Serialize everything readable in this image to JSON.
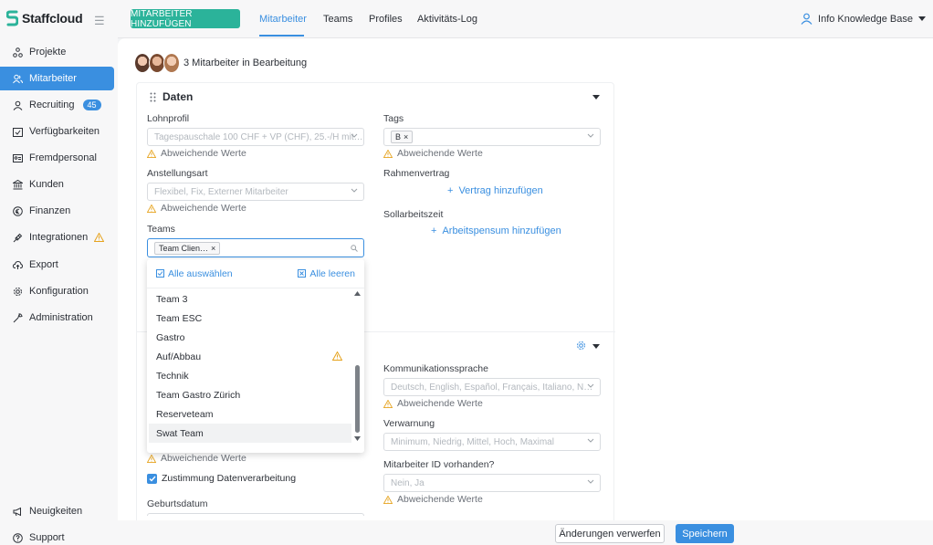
{
  "app": {
    "logo_text": "Staffcloud"
  },
  "sidebar": {
    "items": [
      {
        "label": "Projekte",
        "icon": "projects-icon"
      },
      {
        "label": "Mitarbeiter",
        "icon": "staff-icon"
      },
      {
        "label": "Recruiting",
        "icon": "recruiting-icon",
        "badge": "45"
      },
      {
        "label": "Verfügbarkeiten",
        "icon": "calendar-check-icon"
      },
      {
        "label": "Fremdpersonal",
        "icon": "id-card-icon"
      },
      {
        "label": "Kunden",
        "icon": "bank-icon"
      },
      {
        "label": "Finanzen",
        "icon": "currency-icon"
      },
      {
        "label": "Integrationen",
        "icon": "plug-icon"
      },
      {
        "label": "Export",
        "icon": "cloud-upload-icon"
      },
      {
        "label": "Konfiguration",
        "icon": "gear-icon"
      },
      {
        "label": "Administration",
        "icon": "wrench-icon"
      }
    ],
    "bottom": [
      {
        "label": "Neuigkeiten",
        "icon": "megaphone-icon"
      },
      {
        "label": "Support",
        "icon": "help-icon"
      }
    ]
  },
  "topbar": {
    "add_button": "MITARBEITER HINZUFÜGEN",
    "tabs": [
      "Mitarbeiter",
      "Teams",
      "Profiles",
      "Aktivitäts-Log"
    ],
    "user": "Info Knowledge Base"
  },
  "main": {
    "editing_text": "3 Mitarbeiter in Bearbeitung",
    "section_title": "Daten",
    "fields": {
      "lohnprofil_label": "Lohnprofil",
      "lohnprofil_placeholder": "Tagespauschale 100 CHF + VP (CHF), 25.-/H mit…",
      "anstellungsart_label": "Anstellungsart",
      "anstellungsart_placeholder": "Flexibel, Fix, Externer Mitarbeiter",
      "teams_label": "Teams",
      "teams_tag": "Team Clien…",
      "tags_label": "Tags",
      "tags_tag": "B",
      "rahmenvertrag_label": "Rahmenvertrag",
      "rahmenvertrag_add": "Vertrag hinzufügen",
      "sollarbeitszeit_label": "Sollarbeitszeit",
      "sollarbeitszeit_add": "Arbeitspensum hinzufügen",
      "kommunikationssprache_label": "Kommunikationssprache",
      "kommunikationssprache_placeholder": "Deutsch, English, Español, Français, Italiano, N…",
      "verwarnung_label": "Verwarnung",
      "verwarnung_placeholder": "Minimum, Niedrig, Mittel, Hoch, Maximal",
      "mitarbeiter_id_label": "Mitarbeiter ID vorhanden?",
      "mitarbeiter_id_placeholder": "Nein, Ja",
      "zustimmung_label": "Zustimmung Datenverarbeitung",
      "geburtsdatum_label": "Geburtsdatum"
    },
    "diff_text": "Abweichende Werte"
  },
  "dropdown": {
    "select_all": "Alle auswählen",
    "clear_all": "Alle leeren",
    "items": [
      "Team 3",
      "Team ESC",
      "Gastro",
      "Auf/Abbau",
      "Technik",
      "Team Gastro Zürich",
      "Reserveteam",
      "Swat Team"
    ]
  },
  "footer": {
    "discard": "Änderungen verwerfen",
    "save": "Speichern"
  },
  "colors": {
    "accent": "#3a8fe0",
    "brand": "#2bb39a",
    "warning": "#e6a31e"
  }
}
